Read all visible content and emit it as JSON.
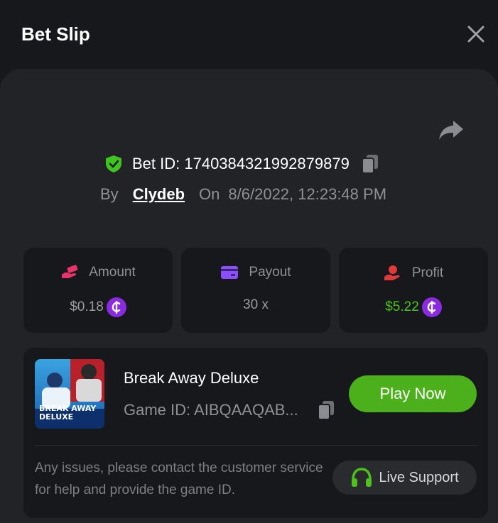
{
  "header": {
    "title": "Bet Slip"
  },
  "bet": {
    "id_text": "Bet ID: 17403843219928798​79",
    "by_label": "By",
    "user": "Clydeb",
    "on_label": "On",
    "date": "8/6/2022, 12:23:48 PM"
  },
  "stats": {
    "amount": {
      "label": "Amount",
      "value": "$0.18"
    },
    "payout": {
      "label": "Payout",
      "value": "30 x"
    },
    "profit": {
      "label": "Profit",
      "value": "$5.22"
    }
  },
  "game": {
    "name": "Break Away Deluxe",
    "id_text": "Game ID: AIBQAAQAB...",
    "play_label": "Play Now",
    "thumb_title_line1": "BREAK AWAY",
    "thumb_title_line2": "DELUXE"
  },
  "support": {
    "help_text": "Any issues, please contact the customer service for help and provide the game ID.",
    "button_label": "Live Support"
  },
  "colors": {
    "background": "#17181b",
    "panel": "#222326",
    "accent_green": "#4cb01c",
    "profit_green": "#4cc21b",
    "coin_purple": "#8a2be2",
    "amount_pink": "#e8336b",
    "payout_purple": "#8b4dff",
    "profit_red": "#e03a3a"
  },
  "icons": {
    "close": "close-icon",
    "share": "share-icon",
    "verified": "shield-check-icon",
    "copy": "copy-icon",
    "amount": "money-hand-icon",
    "payout": "card-icon",
    "profit": "hand-coin-icon",
    "coin": "coin-icon",
    "support": "headset-icon"
  }
}
